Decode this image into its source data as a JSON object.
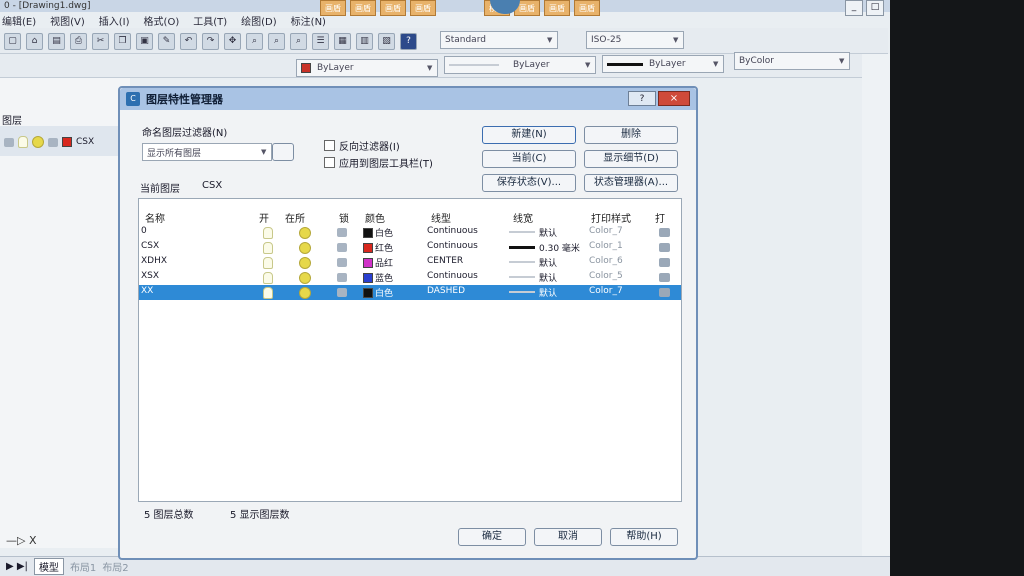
{
  "app": {
    "title_fragment": "0 - [Drawing1.dwg]",
    "menu": [
      "编辑(E)",
      "视图(V)",
      "插入(I)",
      "格式(O)",
      "工具(T)",
      "绘图(D)",
      "标注(N)"
    ],
    "top_tabs": [
      "画盾",
      "画盾",
      "画盾",
      "画盾",
      "画盾",
      "画盾",
      "模式",
      "画盾",
      "画盾",
      "画盾"
    ],
    "text_style": "Standard",
    "dim_style": "ISO-25",
    "layer_combo": "ByLayer",
    "linetype_combo": "ByLayer",
    "lineweight_combo": "ByLayer",
    "plotstyle_combo": "ByColor",
    "left_panel_title": "图层",
    "left_layer_current": "CSX",
    "bottom_tabs": [
      "模型",
      "布局1",
      "布局2"
    ],
    "window_controls": [
      "_",
      "□",
      "×"
    ]
  },
  "dialog": {
    "title": "图层特性管理器",
    "help": "?",
    "close": "×",
    "filter_label": "命名图层过滤器(N)",
    "filter_value": "显示所有图层",
    "chk_invert": "反向过滤器(I)",
    "chk_apply": "应用到图层工具栏(T)",
    "btn_new": "新建(N)",
    "btn_delete": "删除",
    "btn_current": "当前(C)",
    "btn_details": "显示细节(D)",
    "btn_save_state": "保存状态(V)...",
    "btn_state_mgr": "状态管理器(A)...",
    "current_label": "当前图层",
    "current_value": "CSX",
    "columns": [
      "名称",
      "开",
      "在所",
      "锁",
      "颜色",
      "线型",
      "线宽",
      "打印样式",
      "打"
    ],
    "layers": [
      {
        "name": "0",
        "color_name": "白色",
        "color": "#111111",
        "linetype": "Continuous",
        "lineweight": "默认",
        "plotstyle": "Color_7",
        "selected": false
      },
      {
        "name": "CSX",
        "color_name": "红色",
        "color": "#d8281e",
        "linetype": "Continuous",
        "lineweight": "0.30 毫米",
        "plotstyle": "Color_1",
        "selected": false
      },
      {
        "name": "XDHX",
        "color_name": "品红",
        "color": "#d032c8",
        "linetype": "CENTER",
        "lineweight": "默认",
        "plotstyle": "Color_6",
        "selected": false
      },
      {
        "name": "XSX",
        "color_name": "蓝色",
        "color": "#2a3fd0",
        "linetype": "Continuous",
        "lineweight": "默认",
        "plotstyle": "Color_5",
        "selected": false
      },
      {
        "name": "XX",
        "color_name": "白色",
        "color": "#111111",
        "linetype": "DASHED",
        "lineweight": "默认",
        "plotstyle": "Color_7",
        "selected": true
      }
    ],
    "footer_total": "5 图层总数",
    "footer_shown": "5 显示图层数",
    "btn_ok": "确定",
    "btn_cancel": "取消",
    "btn_help": "帮助(H)"
  }
}
